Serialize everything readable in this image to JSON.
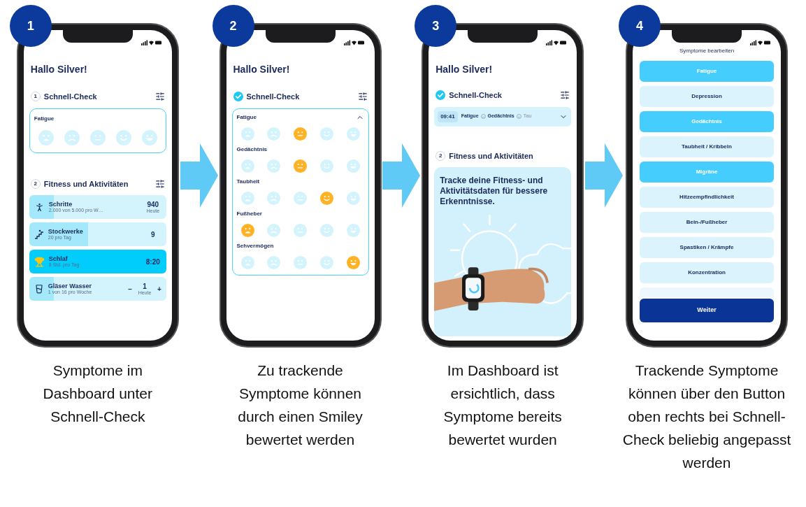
{
  "steps": [
    {
      "number": "1",
      "caption": "Symptome im Dashboard unter Schnell-Check",
      "screen": {
        "kind": "dashboard",
        "greeting": "Hallo Silver!",
        "check_section": {
          "number": "1",
          "title": "Schnell-Check",
          "done": false
        },
        "check_card": {
          "title": "Fatigue",
          "faces": [
            {
              "selected": false
            },
            {
              "selected": false
            },
            {
              "selected": false
            },
            {
              "selected": false
            },
            {
              "selected": false
            }
          ]
        },
        "fitness_section": {
          "number": "2",
          "title": "Fitness und Aktivitäten"
        },
        "activities": [
          {
            "kind": "progress",
            "title": "Schritte",
            "subtitle": "2.000 von 5.000 pro W…",
            "value": "940",
            "value_caption": "Heute",
            "level": 0.18
          },
          {
            "kind": "progress",
            "title": "Stockwerke",
            "subtitle": "20 pro Tag",
            "value": "9",
            "level": 0.43
          },
          {
            "kind": "progress",
            "title": "Schlaf",
            "subtitle": "8 Std. pro Tag",
            "value": "8:20",
            "level": 1
          },
          {
            "kind": "stepper",
            "title": "Gläser Wasser",
            "subtitle": "1 von 16 pro Woche",
            "value": "1",
            "value_caption": "Heute",
            "minus": "−",
            "plus": "+",
            "level": 0.18
          }
        ]
      }
    },
    {
      "number": "2",
      "caption": "Zu trackende Symptome können durch einen Smiley bewertet werden",
      "screen": {
        "kind": "rating",
        "greeting": "Hallo Silver!",
        "check_section": {
          "title": "Schnell-Check",
          "done": true
        },
        "card": {
          "expanded": true,
          "groups": [
            {
              "title": "Fatigue",
              "faces": [
                {
                  "selected": false
                },
                {
                  "selected": false
                },
                {
                  "selected": true
                },
                {
                  "selected": false
                },
                {
                  "selected": false
                }
              ]
            },
            {
              "title": "Gedächtnis",
              "faces": [
                {
                  "selected": false
                },
                {
                  "selected": false
                },
                {
                  "selected": true
                },
                {
                  "selected": false
                },
                {
                  "selected": false
                }
              ]
            },
            {
              "title": "Taubheit",
              "faces": [
                {
                  "selected": false
                },
                {
                  "selected": false
                },
                {
                  "selected": false
                },
                {
                  "selected": true
                },
                {
                  "selected": false
                }
              ]
            },
            {
              "title": "Fußheber",
              "faces": [
                {
                  "selected": true
                },
                {
                  "selected": false
                },
                {
                  "selected": false
                },
                {
                  "selected": false
                },
                {
                  "selected": false
                }
              ]
            },
            {
              "title": "Sehvermögen",
              "faces": [
                {
                  "selected": false
                },
                {
                  "selected": false
                },
                {
                  "selected": false
                },
                {
                  "selected": false
                },
                {
                  "selected": true
                }
              ]
            }
          ]
        }
      }
    },
    {
      "number": "3",
      "caption": "Im Dashboard ist ersichtlich, dass Symptome bereits bewertet wurden",
      "screen": {
        "kind": "summary",
        "greeting": "Hallo Silver!",
        "check_section": {
          "title": "Schnell-Check",
          "done": true
        },
        "summary": {
          "time": "09:41",
          "items": [
            "Fatigue",
            "Gedächtnis",
            "Tau"
          ],
          "expanded": false
        },
        "fitness_section": {
          "number": "2",
          "title": "Fitness und Aktivitäten"
        },
        "promo": "Tracke deine Fitness- und Aktivitätsdaten für bessere Erkenntnisse."
      }
    },
    {
      "number": "4",
      "caption": "Trackende Symptome können über den Button oben rechts bei Schnell-Check beliebig angepasst werden",
      "screen": {
        "kind": "picker",
        "title": "Symptome bearbeiten",
        "symptoms": [
          {
            "label": "Fatigue",
            "selected": true
          },
          {
            "label": "Depression",
            "selected": false
          },
          {
            "label": "Gedächtnis",
            "selected": true
          },
          {
            "label": "Taubheit / Kribbeln",
            "selected": false
          },
          {
            "label": "Migräne",
            "selected": true
          },
          {
            "label": "Hitzeempfindlichkeit",
            "selected": false
          },
          {
            "label": "Bein-/Fußheber",
            "selected": false
          },
          {
            "label": "Spastiken / Krämpfe",
            "selected": false
          },
          {
            "label": "Konzentration",
            "selected": false
          }
        ],
        "button": "Weiter"
      }
    }
  ]
}
